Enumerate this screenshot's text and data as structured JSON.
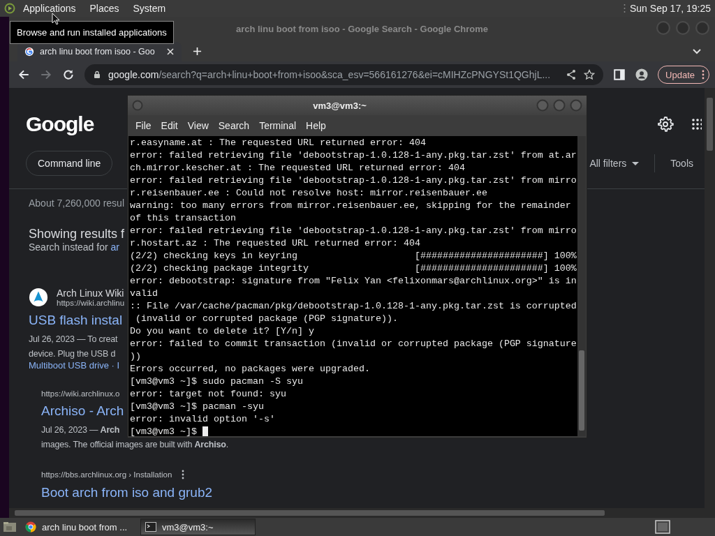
{
  "top_panel": {
    "menus": [
      "Applications",
      "Places",
      "System"
    ],
    "clock": "Sun Sep 17, 19:25"
  },
  "tooltip": "Browse and run installed applications",
  "browser": {
    "title": "arch linu boot from isoo - Google Search - Google Chrome",
    "tabs": [
      {
        "label": "arch linu boot from isoo - Goo",
        "selected": true
      }
    ],
    "forward_disabled": true,
    "address": {
      "host": "google.com",
      "path": "/search?q=arch+linu+boot+from+isoo&sca_esv=566161276&ei=cMIHZcPNGYSt1QGhjL..."
    },
    "update_button": "Update",
    "page": {
      "logo": "Google",
      "filter_chips": [
        "Command line"
      ],
      "all_filters": "All filters",
      "tools": "Tools",
      "result_stats": "About 7,260,000 resul",
      "showing": "Showing results f",
      "search_instead": "Search instead for",
      "search_instead_link": "ar",
      "results": [
        {
          "kind": "main",
          "site": "Arch Linux Wiki",
          "url": "https://wiki.archlinu",
          "title": "USB flash instal",
          "lines": [
            "Jul 26, 2023 — To creat",
            "device. Plug the USB d"
          ],
          "sitelinks": "Multiboot USB drive · I"
        },
        {
          "kind": "indented",
          "url": "https://wiki.archlinux.o",
          "title": "Archiso - Arch",
          "lines": [
            "Jul 26, 2023 — **Arch**",
            "images. The official images are built with **Archiso**."
          ]
        },
        {
          "kind": "indented",
          "url": "https://bbs.archlinux.org › Installation",
          "title": "Boot arch from iso and grub2"
        }
      ]
    }
  },
  "terminal": {
    "title": "vm3@vm3:~",
    "menus": [
      "File",
      "Edit",
      "View",
      "Search",
      "Terminal",
      "Help"
    ],
    "lines": [
      "r.easyname.at : The requested URL returned error: 404",
      "error: failed retrieving file 'debootstrap-1.0.128-1-any.pkg.tar.zst' from at.ar",
      "ch.mirror.kescher.at : The requested URL returned error: 404",
      "error: failed retrieving file 'debootstrap-1.0.128-1-any.pkg.tar.zst' from mirro",
      "r.reisenbauer.ee : Could not resolve host: mirror.reisenbauer.ee",
      "warning: too many errors from mirror.reisenbauer.ee, skipping for the remainder",
      "of this transaction",
      "error: failed retrieving file 'debootstrap-1.0.128-1-any.pkg.tar.zst' from mirro",
      "r.hostart.az : The requested URL returned error: 404",
      "(2/2) checking keys in keyring                     [######################] 100%",
      "(2/2) checking package integrity                   [######################] 100%",
      "error: debootstrap: signature from \"Felix Yan <felixonmars@archlinux.org>\" is in",
      "valid",
      ":: File /var/cache/pacman/pkg/debootstrap-1.0.128-1-any.pkg.tar.zst is corrupted",
      " (invalid or corrupted package (PGP signature)).",
      "Do you want to delete it? [Y/n] y",
      "error: failed to commit transaction (invalid or corrupted package (PGP signature",
      "))",
      "Errors occurred, no packages were upgraded.",
      "[vm3@vm3 ~]$ sudo pacman -S syu",
      "error: target not found: syu",
      "[vm3@vm3 ~]$ pacman -syu",
      "error: invalid option '-s'"
    ],
    "prompt": "[vm3@vm3 ~]$"
  },
  "taskbar": {
    "items": [
      {
        "kind": "browser",
        "label": "arch linu boot from ...",
        "selected": false
      },
      {
        "kind": "terminal",
        "label": "vm3@vm3:~",
        "selected": true
      }
    ]
  }
}
